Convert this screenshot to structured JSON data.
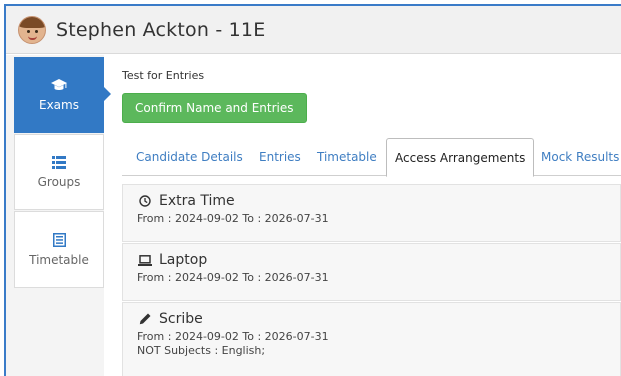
{
  "header": {
    "student_name": "Stephen Ackton - 11E"
  },
  "sidebar": {
    "items": [
      {
        "label": "Exams",
        "icon": "graduation-cap-icon",
        "active": true
      },
      {
        "label": "Groups",
        "icon": "list-icon",
        "active": false
      },
      {
        "label": "Timetable",
        "icon": "table-icon",
        "active": false
      }
    ]
  },
  "main": {
    "test_label": "Test for Entries",
    "confirm_button": "Confirm Name and Entries",
    "tabs": [
      {
        "label": "Candidate Details",
        "active": false
      },
      {
        "label": "Entries",
        "active": false
      },
      {
        "label": "Timetable",
        "active": false
      },
      {
        "label": "Access Arrangements",
        "active": true
      },
      {
        "label": "Mock Results",
        "active": false
      }
    ],
    "arrangements": [
      {
        "title": "Extra Time",
        "icon": "clock-icon",
        "dates": "From : 2024-09-02 To : 2026-07-31"
      },
      {
        "title": "Laptop",
        "icon": "laptop-icon",
        "dates": "From : 2024-09-02 To : 2026-07-31"
      },
      {
        "title": "Scribe",
        "icon": "pencil-icon",
        "dates": "From : 2024-09-02 To : 2026-07-31",
        "note": "NOT Subjects : English;"
      }
    ]
  },
  "colors": {
    "accent": "#3279c5",
    "confirm": "#5cb85c",
    "tab_link": "#3f7ec2"
  }
}
